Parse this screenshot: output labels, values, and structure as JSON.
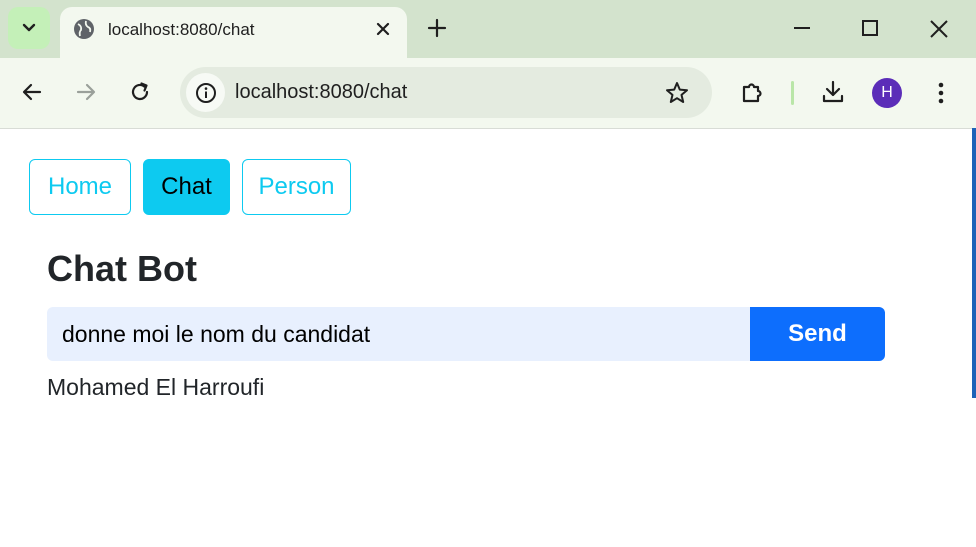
{
  "browser": {
    "tab_title": "localhost:8080/chat",
    "url": "localhost:8080/chat",
    "profile_initial": "H",
    "accent": "#0dcaf0"
  },
  "nav": {
    "items": [
      {
        "label": "Home",
        "active": false
      },
      {
        "label": "Chat",
        "active": true
      },
      {
        "label": "Person",
        "active": false
      }
    ]
  },
  "chat": {
    "title": "Chat Bot",
    "input_value": "donne moi le nom du candidat",
    "send_label": "Send",
    "response": "Mohamed El Harroufi"
  },
  "colors": {
    "primary": "#0d6efd",
    "info": "#0dcaf0",
    "input_bg": "#e8f0fe"
  }
}
